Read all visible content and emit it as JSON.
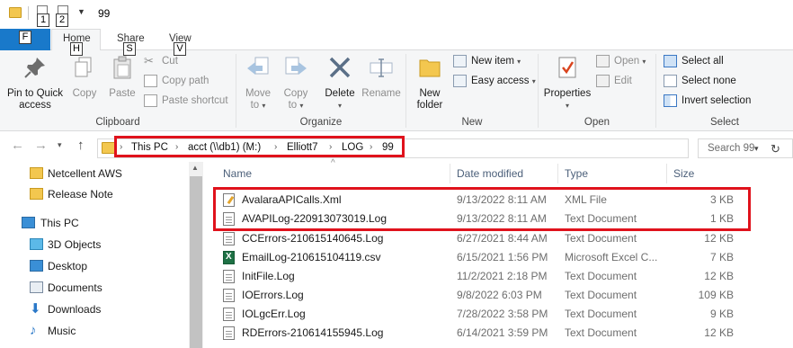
{
  "window": {
    "title": "99",
    "quick_access_badges": [
      "1",
      "2"
    ]
  },
  "ribbon_tabs": {
    "file": {
      "label": "File",
      "keytip": "F"
    },
    "home": {
      "label": "Home",
      "keytip": "H"
    },
    "share": {
      "label": "Share",
      "keytip": "S"
    },
    "view": {
      "label": "View",
      "keytip": "V"
    }
  },
  "ribbon": {
    "clipboard": {
      "group_label": "Clipboard",
      "pin_to_quick_access_line1": "Pin to Quick",
      "pin_to_quick_access_line2": "access",
      "copy": "Copy",
      "paste": "Paste",
      "cut": "Cut",
      "copy_path": "Copy path",
      "paste_shortcut": "Paste shortcut"
    },
    "organize": {
      "group_label": "Organize",
      "move_to_line1": "Move",
      "move_to_line2": "to",
      "copy_to_line1": "Copy",
      "copy_to_line2": "to",
      "delete": "Delete",
      "rename": "Rename"
    },
    "new": {
      "group_label": "New",
      "new_folder_line1": "New",
      "new_folder_line2": "folder",
      "new_item": "New item",
      "easy_access": "Easy access"
    },
    "open": {
      "group_label": "Open",
      "properties": "Properties",
      "open": "Open",
      "edit": "Edit"
    },
    "select": {
      "group_label": "Select",
      "select_all": "Select all",
      "select_none": "Select none",
      "invert_selection": "Invert selection"
    }
  },
  "address_bar": {
    "crumbs": [
      "This PC",
      "acct (\\\\db1) (M:)",
      "Elliott7",
      "LOG",
      "99"
    ],
    "search_placeholder": "Search 99"
  },
  "nav_pane": {
    "items": [
      {
        "label": "Netcellent AWS",
        "icon": "pinned-folder-icon"
      },
      {
        "label": "Release Note",
        "icon": "folder-icon"
      },
      {
        "label": "This PC",
        "icon": "computer-icon"
      },
      {
        "label": "3D Objects",
        "icon": "3d-objects-icon"
      },
      {
        "label": "Desktop",
        "icon": "desktop-folder-icon"
      },
      {
        "label": "Documents",
        "icon": "documents-folder-icon"
      },
      {
        "label": "Downloads",
        "icon": "downloads-icon"
      },
      {
        "label": "Music",
        "icon": "music-icon"
      }
    ]
  },
  "file_list": {
    "columns": {
      "name": "Name",
      "date_modified": "Date modified",
      "type": "Type",
      "size": "Size"
    },
    "rows": [
      {
        "name": "AvalaraAPICalls.Xml",
        "date": "9/13/2022 8:11 AM",
        "type": "XML File",
        "size": "3 KB",
        "icon": "xml-file-icon"
      },
      {
        "name": "AVAPILog-220913073019.Log",
        "date": "9/13/2022 8:11 AM",
        "type": "Text Document",
        "size": "1 KB",
        "icon": "text-file-icon"
      },
      {
        "name": "CCErrors-210615140645.Log",
        "date": "6/27/2021 8:44 AM",
        "type": "Text Document",
        "size": "12 KB",
        "icon": "text-file-icon"
      },
      {
        "name": "EmailLog-210615104119.csv",
        "date": "6/15/2021 1:56 PM",
        "type": "Microsoft Excel C...",
        "size": "7 KB",
        "icon": "excel-file-icon"
      },
      {
        "name": "InitFile.Log",
        "date": "11/2/2021 2:18 PM",
        "type": "Text Document",
        "size": "12 KB",
        "icon": "text-file-icon"
      },
      {
        "name": "IOErrors.Log",
        "date": "9/8/2022 6:03 PM",
        "type": "Text Document",
        "size": "109 KB",
        "icon": "text-file-icon"
      },
      {
        "name": "IOLgcErr.Log",
        "date": "7/28/2022 3:58 PM",
        "type": "Text Document",
        "size": "9 KB",
        "icon": "text-file-icon"
      },
      {
        "name": "RDErrors-210614155945.Log",
        "date": "6/14/2021 3:59 PM",
        "type": "Text Document",
        "size": "12 KB",
        "icon": "text-file-icon"
      }
    ]
  },
  "colors": {
    "file_tab": "#1979ca",
    "highlight": "#e0121c",
    "folder": "#f3c74f",
    "column_header_text": "#4c607a"
  }
}
